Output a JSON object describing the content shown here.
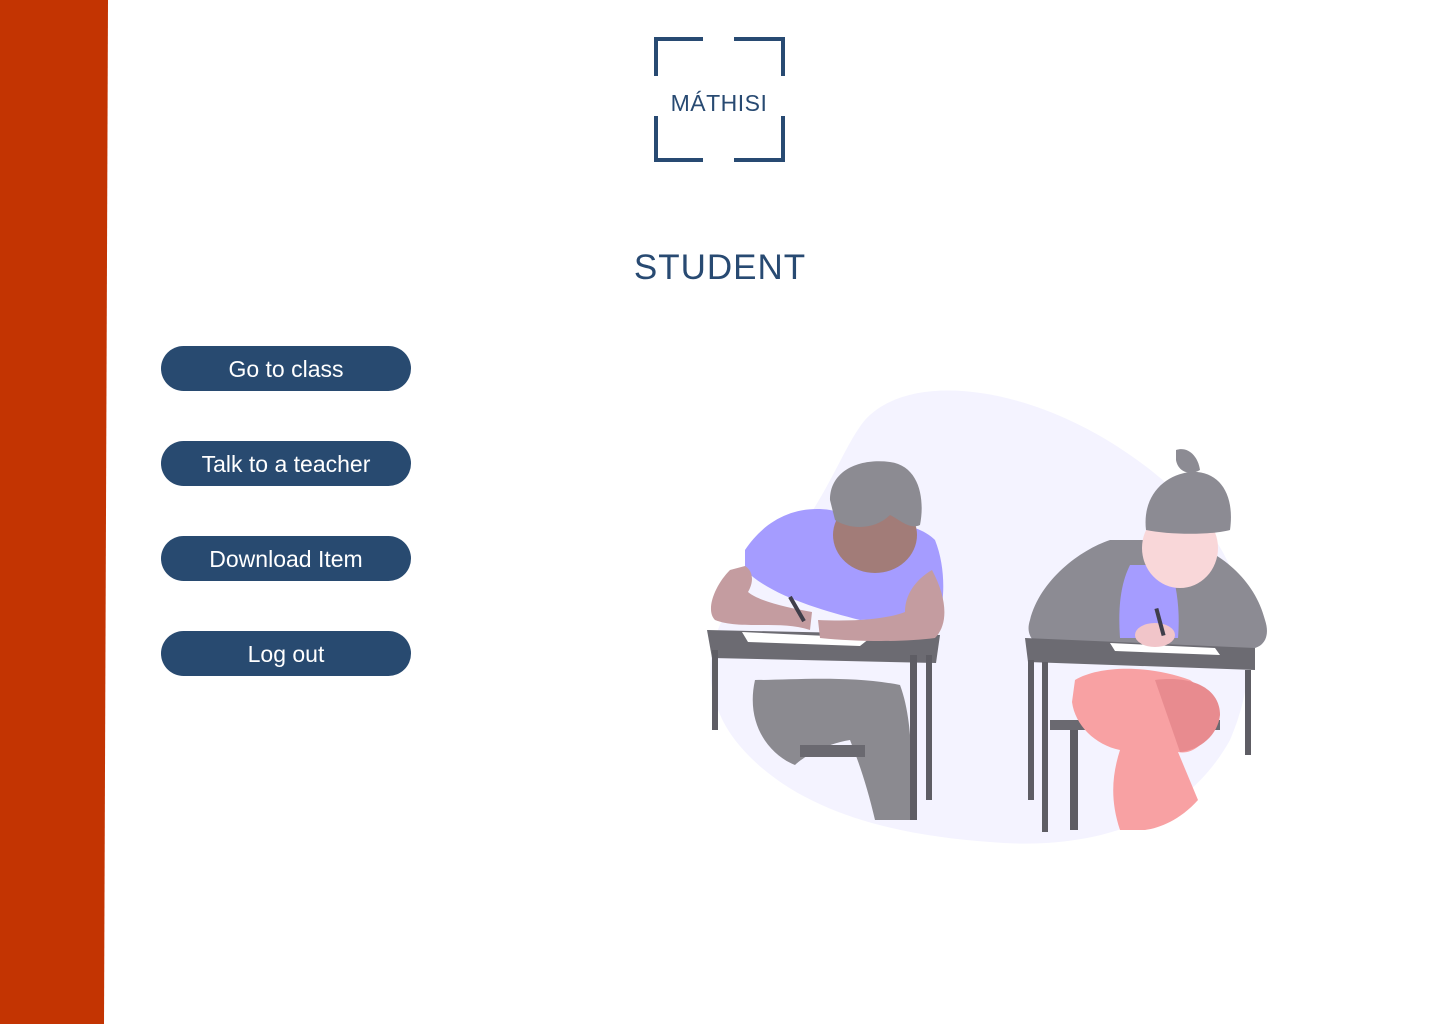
{
  "app": {
    "logo_text": "MÁTHISI",
    "page_title": "STUDENT"
  },
  "menu": {
    "items": [
      {
        "label": "Go to class"
      },
      {
        "label": "Talk to a teacher"
      },
      {
        "label": "Download Item"
      },
      {
        "label": "Log out"
      }
    ]
  },
  "colors": {
    "sidebar": "#c33402",
    "primary": "#284a70",
    "illustration_accent": "#a59cff",
    "illustration_background": "#f4f3ff"
  },
  "illustration": {
    "icon": "students-writing-exam-illustration"
  }
}
